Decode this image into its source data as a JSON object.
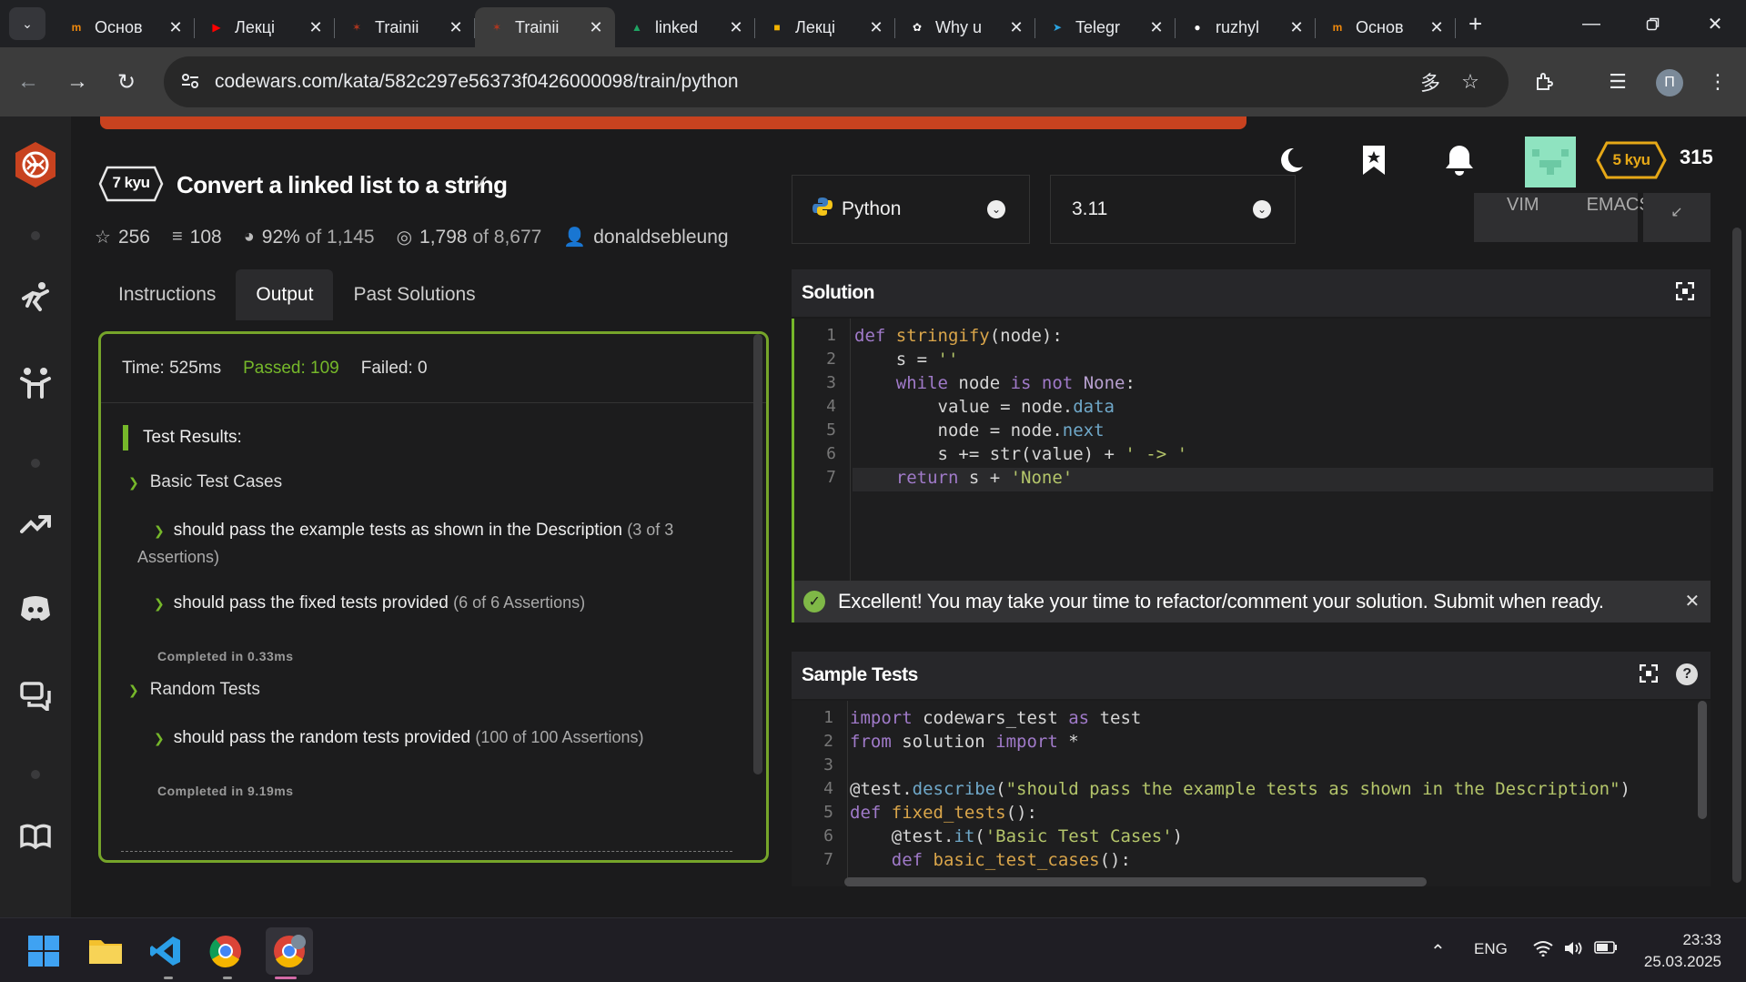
{
  "browser": {
    "tabs": [
      {
        "title": "Основ",
        "icon": "moodle-icon",
        "color": "#f0890c",
        "active": false
      },
      {
        "title": "Лекці",
        "icon": "youtube-icon",
        "color": "#ff0000",
        "active": false
      },
      {
        "title": "Trainii",
        "icon": "codewars-icon",
        "color": "#b1361e",
        "active": false
      },
      {
        "title": "Trainii",
        "icon": "codewars-icon",
        "color": "#b1361e",
        "active": true
      },
      {
        "title": "linked",
        "icon": "google-drive-icon",
        "color": "#1fa463",
        "active": false
      },
      {
        "title": "Лекці",
        "icon": "google-slides-icon",
        "color": "#f4b400",
        "active": false
      },
      {
        "title": "Why u",
        "icon": "chatgpt-icon",
        "color": "#ffffff",
        "active": false
      },
      {
        "title": "Telegr",
        "icon": "telegram-icon",
        "color": "#2aa3e0",
        "active": false
      },
      {
        "title": "ruzhyl",
        "icon": "github-icon",
        "color": "#ffffff",
        "active": false
      },
      {
        "title": "Основ",
        "icon": "moodle-icon",
        "color": "#f0890c",
        "active": false
      }
    ],
    "url": "codewars.com/kata/582c297e56373f0426000098/train/python",
    "profile_initial": "П"
  },
  "header": {
    "rank_badge": "5 kyu",
    "honor": "315"
  },
  "kata": {
    "kyu": "7 kyu",
    "title": "Convert a linked list to a string",
    "stars": "256",
    "collections": "108",
    "satisfaction": "92%",
    "satisfaction_of": "of 1,145",
    "completed": "1,798",
    "completed_of": "of 8,677",
    "author": "donaldsebleung"
  },
  "panel_tabs": [
    "Instructions",
    "Output",
    "Past Solutions"
  ],
  "output": {
    "time": "Time: 525ms",
    "passed": "Passed: 109",
    "failed": "Failed: 0",
    "results_title": "Test Results:",
    "groups": [
      {
        "name": "Basic Test Cases",
        "items": [
          {
            "text": "should pass the example tests as shown in the Description",
            "count": "(3 of 3",
            "count2": "Assertions)"
          },
          {
            "text": "should pass the fixed tests provided",
            "count": "(6 of 6 Assertions)"
          }
        ],
        "completed": "Completed in 0.33ms"
      },
      {
        "name": "Random Tests",
        "items": [
          {
            "text": "should pass the random tests provided",
            "count": "(100 of 100 Assertions)"
          }
        ],
        "completed": "Completed in 9.19ms"
      }
    ]
  },
  "editor": {
    "language": "Python",
    "version": "3.11",
    "modes": [
      "VIM",
      "EMACS"
    ],
    "solution_title": "Solution",
    "solution_lines": [
      "1",
      "2",
      "3",
      "4",
      "5",
      "6",
      "7"
    ],
    "notice": "Excellent! You may take your time to refactor/comment your solution. Submit when ready.",
    "tests_title": "Sample Tests",
    "test_lines": [
      "1",
      "2",
      "3",
      "4",
      "5",
      "6",
      "7"
    ]
  },
  "taskbar": {
    "lang": "ENG",
    "time": "23:33",
    "date": "25.03.2025"
  }
}
